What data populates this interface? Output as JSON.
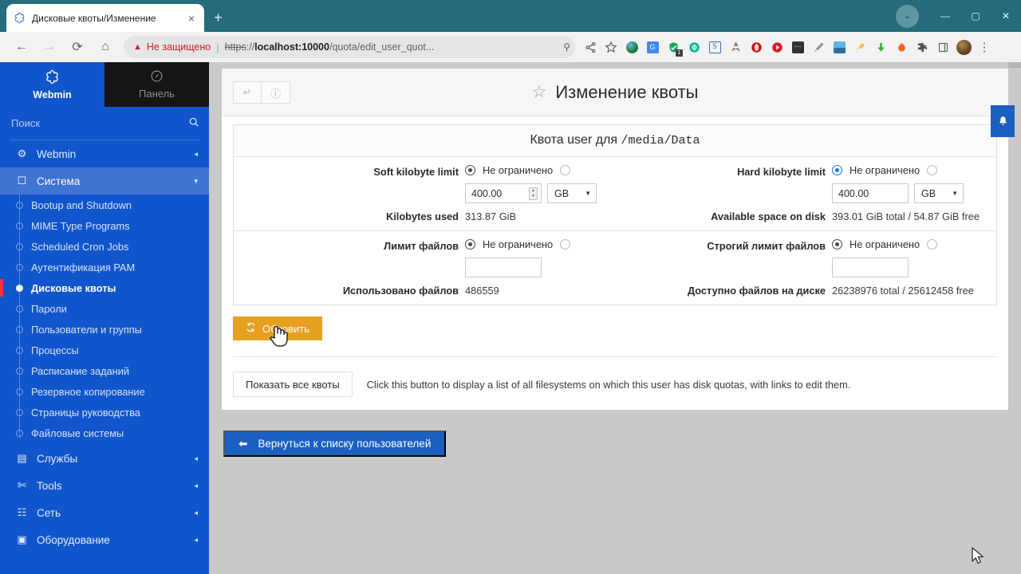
{
  "browser": {
    "tab": {
      "title": "Дисковые квоты/Изменение",
      "favicon": "webmin-favicon",
      "close": "×"
    },
    "new_tab": "+",
    "window": {
      "minimize": "—",
      "maximize": "▢",
      "close": "✕",
      "profile": "⌄"
    },
    "nav": {
      "back": "←",
      "forward": "→",
      "reload": "⟳",
      "home": "⌂"
    },
    "omnibox": {
      "warning": "Не защищено",
      "warning_icon": "warning-triangle",
      "separator": "|",
      "scheme": "https",
      "scheme_suffix": "://",
      "host": "localhost:10000",
      "path": "/quota/edit_user_quot...",
      "key_icon": "password-key-icon"
    },
    "toolbar_icons": [
      "share-icon",
      "bookmark-star-icon",
      "globe-extension",
      "google-translate-extension",
      "checkmark-shield-extension",
      "sync-extension",
      "s-extension",
      "recycle-extension",
      "opera-extension",
      "video-player-extension",
      "dots-grid-extension",
      "color-picker-extension",
      "screenshot-extension",
      "broom-extension",
      "download-extension",
      "fire-extension",
      "puzzle-extensions-icon",
      "side-panel-icon",
      "profile-avatar",
      "chrome-menu-icon"
    ],
    "badge_count": "1"
  },
  "sidebar": {
    "brand": {
      "label": "Webmin",
      "icon": "webmin-logo"
    },
    "panel": {
      "label": "Панель",
      "icon": "dashboard-icon"
    },
    "search": {
      "placeholder": "Поиск",
      "value": "",
      "icon": "search-icon"
    },
    "groups": [
      {
        "label": "Webmin",
        "icon": "gear-icon",
        "arrow": "◂",
        "open": false
      },
      {
        "label": "Система",
        "icon": "monitor-icon",
        "arrow": "▾",
        "open": true
      }
    ],
    "system_items": [
      {
        "label": "Bootup and Shutdown",
        "active": false
      },
      {
        "label": "MIME Type Programs",
        "active": false
      },
      {
        "label": "Scheduled Cron Jobs",
        "active": false
      },
      {
        "label": "Аутентификация PAM",
        "active": false
      },
      {
        "label": "Дисковые квоты",
        "active": true
      },
      {
        "label": "Пароли",
        "active": false
      },
      {
        "label": "Пользователи и группы",
        "active": false
      },
      {
        "label": "Процессы",
        "active": false
      },
      {
        "label": "Расписание заданий",
        "active": false
      },
      {
        "label": "Резервное копирование",
        "active": false
      },
      {
        "label": "Страницы руководства",
        "active": false
      },
      {
        "label": "Файловые системы",
        "active": false
      }
    ],
    "bottom_groups": [
      {
        "label": "Службы",
        "icon": "server-icon",
        "arrow": "◂"
      },
      {
        "label": "Tools",
        "icon": "tools-icon",
        "arrow": "◂"
      },
      {
        "label": "Сеть",
        "icon": "network-icon",
        "arrow": "◂"
      },
      {
        "label": "Оборудование",
        "icon": "hardware-icon",
        "arrow": "◂"
      }
    ]
  },
  "page": {
    "header": {
      "back_button_icon": "return-arrow-icon",
      "help_button_icon": "help-question-icon",
      "star_icon": "favorite-star-icon",
      "title": "Изменение квоты",
      "bell_icon": "notification-bell-icon"
    },
    "quota_box": {
      "title_prefix": "Квота user для ",
      "title_path": "/media/Data",
      "radio_unlimited_label": "Не ограничено",
      "rows": [
        {
          "left": {
            "label": "Soft kilobyte limit",
            "unlimited_selected": true,
            "focused": false,
            "value": "400.00",
            "has_spinner": true,
            "unit": "GB",
            "info_label": "Kilobytes used",
            "info_value": "313.87 GiB"
          },
          "right": {
            "label": "Hard kilobyte limit",
            "unlimited_selected": true,
            "focused": true,
            "value": "400.00",
            "has_spinner": false,
            "unit": "GB",
            "info_label": "Available space on disk",
            "info_value": "393.01 GiB total / 54.87 GiB free"
          }
        },
        {
          "left": {
            "label": "Лимит файлов",
            "unlimited_selected": true,
            "focused": false,
            "value": "",
            "has_spinner": false,
            "unit": null,
            "info_label": "Использовано файлов",
            "info_value": "486559"
          },
          "right": {
            "label": "Строгий лимит файлов",
            "unlimited_selected": true,
            "focused": false,
            "value": "",
            "has_spinner": false,
            "unit": null,
            "info_label": "Доступно файлов на диске",
            "info_value": "26238976 total / 25612458 free"
          }
        }
      ]
    },
    "update_button": {
      "label": "Обновить",
      "icon": "refresh-icon",
      "color": "#e8a020"
    },
    "show_all": {
      "button_label": "Показать все квоты",
      "description": "Click this button to display a list of all filesystems on which this user has disk quotas, with links to edit them."
    },
    "return_button": {
      "label": "Вернуться к списку пользователей",
      "icon": "arrow-left-icon",
      "color": "#1b5fc1"
    }
  },
  "cursors": {
    "hand_pointer": "pointing-hand-cursor",
    "arrow": "arrow-cursor"
  }
}
